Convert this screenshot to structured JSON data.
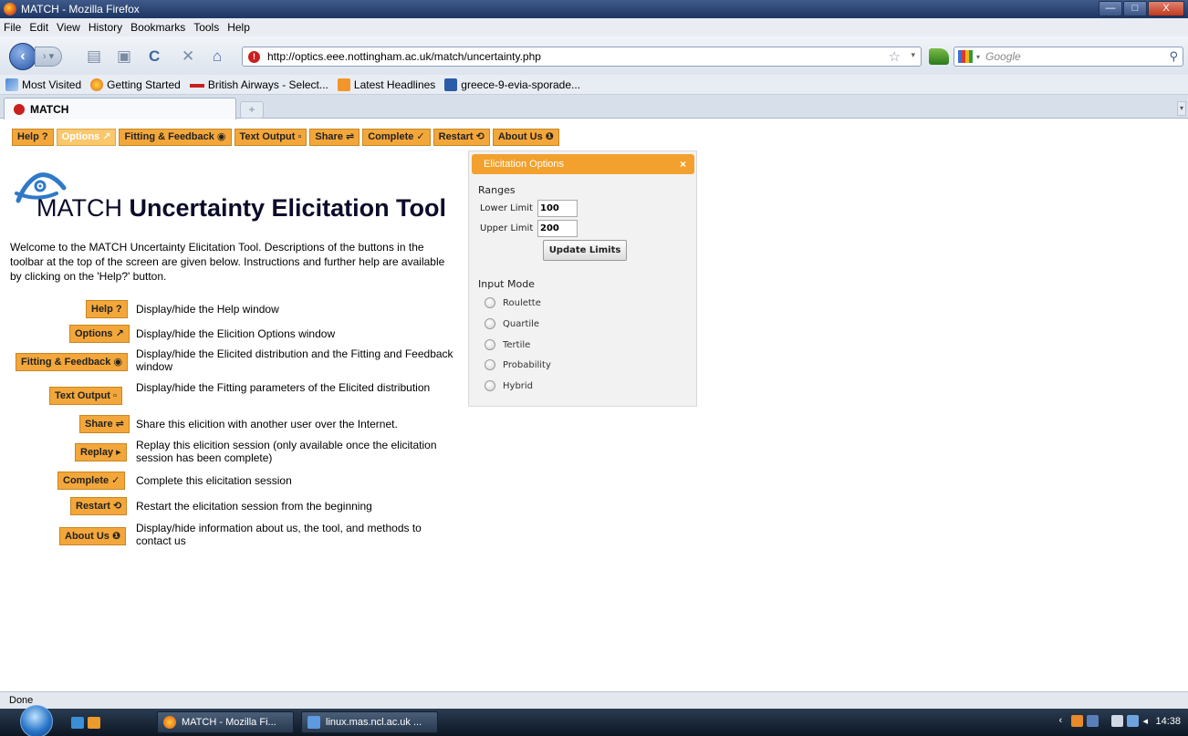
{
  "window": {
    "title": "MATCH - Mozilla Firefox",
    "min": "—",
    "max": "□",
    "close": "X"
  },
  "menu": [
    "File",
    "Edit",
    "View",
    "History",
    "Bookmarks",
    "Tools",
    "Help"
  ],
  "nav": {
    "url": "http://optics.eee.nottingham.ac.uk/match/uncertainty.php",
    "search_placeholder": "Google"
  },
  "bookmarks": [
    "Most Visited",
    "Getting Started",
    "British Airways - Select...",
    "Latest Headlines",
    "greece-9-evia-sporade..."
  ],
  "tab": {
    "title": "MATCH",
    "new_tab": "+"
  },
  "toolbar": {
    "help": "Help ?",
    "options": "Options ↗",
    "fitting": "Fitting & Feedback ◉",
    "text_output": "Text Output ▫",
    "share": "Share ⇌",
    "complete": "Complete ✓",
    "restart": "Restart ⟲",
    "about": "About Us ❶"
  },
  "page": {
    "title_match": "MATCH",
    "title_rest": " Uncertainty Elicitation Tool",
    "intro": "Welcome to the MATCH Uncertainty Elicitation Tool. Descriptions of the buttons in the toolbar at the top of the screen are given below. Instructions and further help are available by clicking on the 'Help?' button."
  },
  "descriptions": [
    {
      "button": "Help ?",
      "text": "Display/hide the Help window"
    },
    {
      "button": "Options ↗",
      "text": "Display/hide the Elicition Options window"
    },
    {
      "button": "Fitting & Feedback ◉",
      "text": "Display/hide the Elicited distribution and the Fitting and Feedback window"
    },
    {
      "button": "Text Output ▫",
      "text": "Display/hide the Fitting parameters of the Elicited distribution"
    },
    {
      "button": "Share ⇌",
      "text": "Share this elicition with another user over the Internet."
    },
    {
      "button": "Replay ▸",
      "text": "Replay this elicition session (only available once the elicitation session has been complete)"
    },
    {
      "button": "Complete ✓",
      "text": "Complete this elicitation session"
    },
    {
      "button": "Restart ⟲",
      "text": "Restart the elicitation session from the beginning"
    },
    {
      "button": "About Us ❶",
      "text": "Display/hide information about us, the tool, and methods to contact us"
    }
  ],
  "panel": {
    "title": "Elicitation Options",
    "close": "×",
    "ranges_label": "Ranges",
    "lower_label": "Lower Limit",
    "lower_value": "100",
    "upper_label": "Upper Limit",
    "upper_value": "200",
    "update_button": "Update Limits",
    "input_mode_label": "Input Mode",
    "modes": [
      "Roulette",
      "Quartile",
      "Tertile",
      "Probability",
      "Hybrid"
    ]
  },
  "status": "Done",
  "taskbar": {
    "task1": "MATCH - Mozilla Fi...",
    "task2": "linux.mas.ncl.ac.uk ...",
    "clock": "14:38"
  },
  "colors": {
    "accent": "#f3a73b",
    "accent_border": "#c98520",
    "panel_head": "#f2a12e"
  },
  "icons": [
    "firefox-icon",
    "back-arrow-icon",
    "forward-arrow-icon",
    "reload-icon",
    "stop-icon",
    "home-icon",
    "star-icon",
    "search-icon",
    "match-logo-icon"
  ]
}
